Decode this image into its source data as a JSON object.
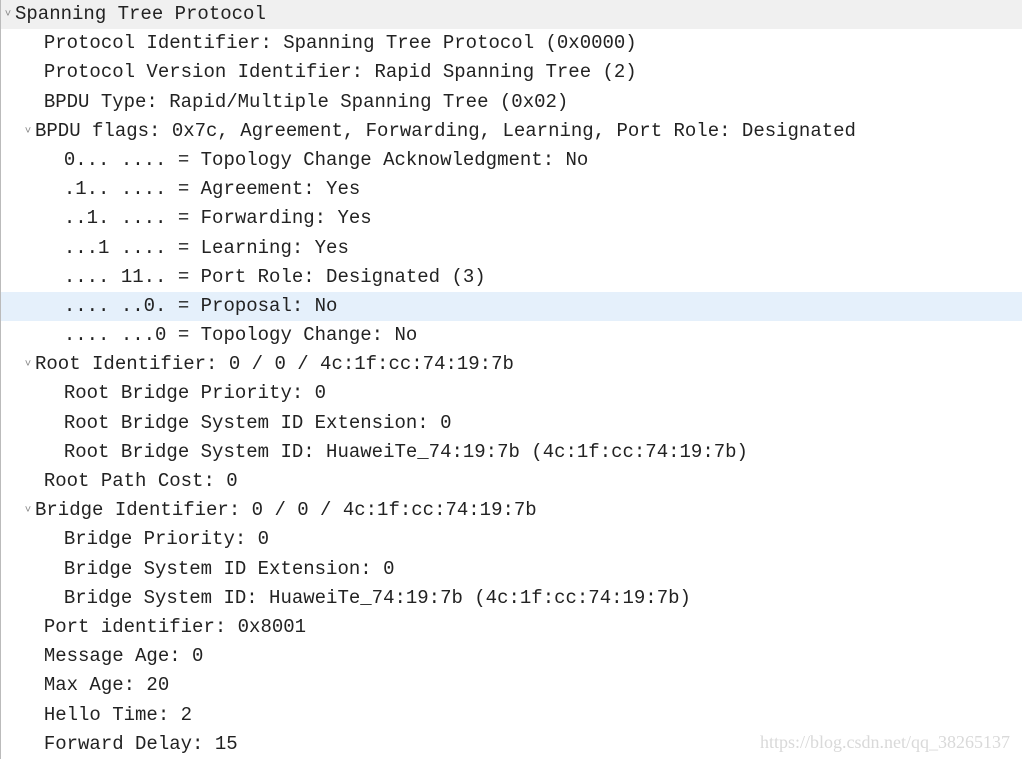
{
  "glyphs": {
    "down": "˅"
  },
  "header": {
    "title": "Spanning Tree Protocol"
  },
  "lines": {
    "proto_id": "Protocol Identifier: Spanning Tree Protocol (0x0000)",
    "proto_ver": "Protocol Version Identifier: Rapid Spanning Tree (2)",
    "bpdu_type": "BPDU Type: Rapid/Multiple Spanning Tree (0x02)",
    "bpdu_flags": "BPDU flags: 0x7c, Agreement, Forwarding, Learning, Port Role: Designated",
    "flag_tca": "0... .... = Topology Change Acknowledgment: No",
    "flag_agree": ".1.. .... = Agreement: Yes",
    "flag_fwd": "..1. .... = Forwarding: Yes",
    "flag_learn": "...1 .... = Learning: Yes",
    "flag_role": ".... 11.. = Port Role: Designated (3)",
    "flag_prop": ".... ..0. = Proposal: No",
    "flag_tc": ".... ...0 = Topology Change: No",
    "root_id": "Root Identifier: 0 / 0 / 4c:1f:cc:74:19:7b",
    "root_prio": "Root Bridge Priority: 0",
    "root_ext": "Root Bridge System ID Extension: 0",
    "root_sys": "Root Bridge System ID: HuaweiTe_74:19:7b (4c:1f:cc:74:19:7b)",
    "root_cost": "Root Path Cost: 0",
    "bridge_id": "Bridge Identifier: 0 / 0 / 4c:1f:cc:74:19:7b",
    "bridge_prio": "Bridge Priority: 0",
    "bridge_ext": "Bridge System ID Extension: 0",
    "bridge_sys": "Bridge System ID: HuaweiTe_74:19:7b (4c:1f:cc:74:19:7b)",
    "port_id": "Port identifier: 0x8001",
    "msg_age": "Message Age: 0",
    "max_age": "Max Age: 20",
    "hello": "Hello Time: 2",
    "fwd_delay": "Forward Delay: 15"
  },
  "watermark": "https://blog.csdn.net/qq_38265137"
}
